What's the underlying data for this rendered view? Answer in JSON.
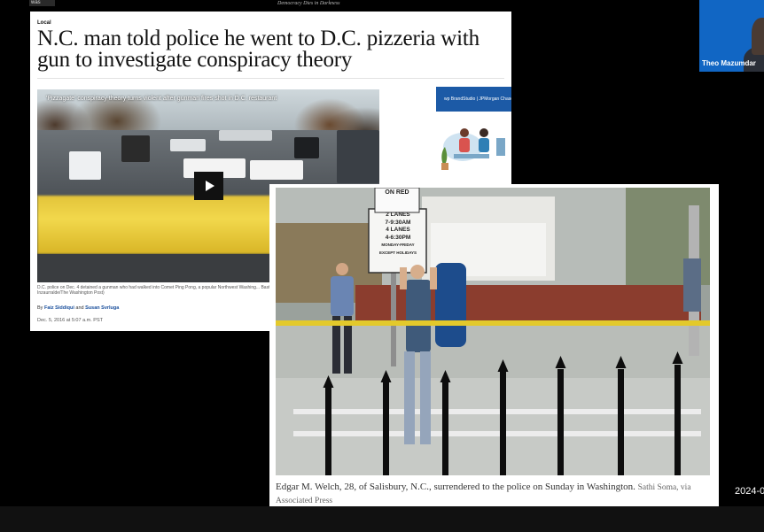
{
  "corner": {
    "logo_text": "was",
    "top_tag": "Democracy Dies in Darkness"
  },
  "article": {
    "section": "Local",
    "headline": "N.C. man told police he went to D.C. pizzeria with gun to investigate conspiracy theory",
    "video_title": "'Pizzagate' conspiracy theory turns violent after gunman fires shot in D.C. restaurant",
    "caption": "D.C. police on Dec. 4 detained a gunman who had walked into Comet Ping Pong, a popular Northwest Washing... Bastien Inzaurralde/The Washington Post)",
    "byline_prefix": "By",
    "author1": "Faiz Siddiqui",
    "byline_join": "and",
    "author2": "Susan Svrluga",
    "dateline": "Dec. 5, 2016 at 5:07 a.m. PST",
    "ad_label": "wp BrandStudio | JPMorgan Chase"
  },
  "photo": {
    "sign_top": "ON RED",
    "sign_text": [
      "2 LANES",
      "7-9:30AM",
      "4 LANES",
      "4-6:30PM",
      "MONDAY-FRIDAY",
      "EXCEPT HOLIDAYS"
    ],
    "caption": "Edgar M. Welch, 28, of Salisbury, N.C., surrendered to the police on Sunday in Washington.",
    "credit": "Sathi Soma, via Associated Press"
  },
  "participant": {
    "name": "Theo Mazumdar"
  },
  "clock": "2024-0",
  "colors": {
    "background": "#000000",
    "tape": "#f2d84c",
    "ad_blue": "#1c5aa6",
    "tile_blue": "#1166c4"
  }
}
